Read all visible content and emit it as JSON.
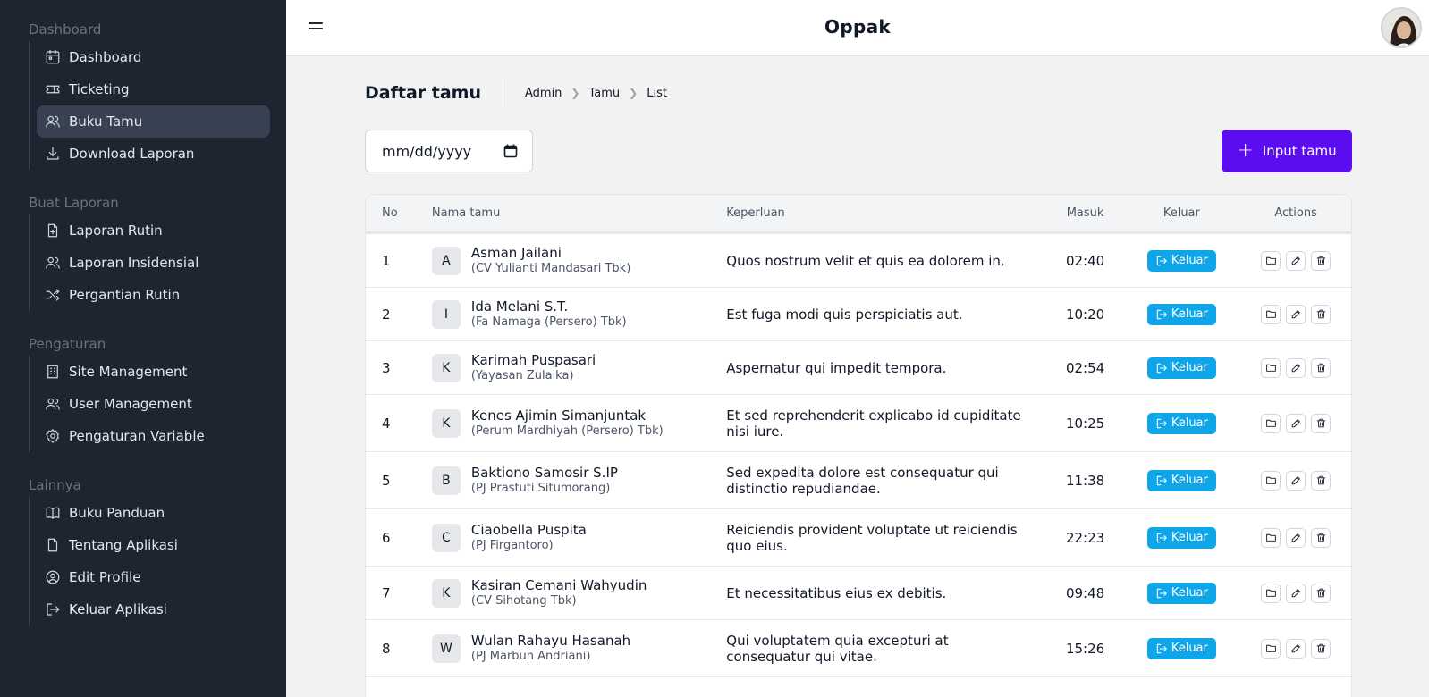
{
  "app": {
    "title": "Oppak"
  },
  "sidebar": {
    "sections": [
      {
        "title": "Dashboard",
        "items": [
          {
            "label": "Dashboard",
            "icon": "calendar-icon"
          },
          {
            "label": "Ticketing",
            "icon": "ticket-icon"
          },
          {
            "label": "Buku Tamu",
            "icon": "users-icon",
            "active": true
          },
          {
            "label": "Download Laporan",
            "icon": "download-icon"
          }
        ]
      },
      {
        "title": "Buat Laporan",
        "items": [
          {
            "label": "Laporan Rutin",
            "icon": "file-plus-icon"
          },
          {
            "label": "Laporan Insidensial",
            "icon": "users-icon"
          },
          {
            "label": "Pergantian Rutin",
            "icon": "shuffle-icon"
          }
        ]
      },
      {
        "title": "Pengaturan",
        "items": [
          {
            "label": "Site Management",
            "icon": "building-icon"
          },
          {
            "label": "User Management",
            "icon": "users-icon"
          },
          {
            "label": "Pengaturan Variable",
            "icon": "gear-icon"
          }
        ]
      },
      {
        "title": "Lainnya",
        "items": [
          {
            "label": "Buku Panduan",
            "icon": "book-icon"
          },
          {
            "label": "Tentang Aplikasi",
            "icon": "file-icon"
          },
          {
            "label": "Edit Profile",
            "icon": "user-circle-icon"
          },
          {
            "label": "Keluar Aplikasi",
            "icon": "logout-icon"
          }
        ]
      }
    ]
  },
  "page": {
    "title": "Daftar tamu",
    "breadcrumb": [
      "Admin",
      "Tamu",
      "List"
    ],
    "date_placeholder": "mm/dd/yyyy",
    "input_button": "Input tamu"
  },
  "table": {
    "columns": [
      "No",
      "Nama tamu",
      "Keperluan",
      "Masuk",
      "Keluar",
      "Actions"
    ],
    "keluar_label": "Keluar",
    "rows": [
      {
        "no": "1",
        "initial": "A",
        "name": "Asman Jailani",
        "org": "(CV Yulianti Mandasari Tbk)",
        "keperluan": "Quos nostrum velit et quis ea dolorem in.",
        "masuk": "02:40"
      },
      {
        "no": "2",
        "initial": "I",
        "name": "Ida Melani S.T.",
        "org": "(Fa Namaga (Persero) Tbk)",
        "keperluan": "Est fuga modi quis perspiciatis aut.",
        "masuk": "10:20"
      },
      {
        "no": "3",
        "initial": "K",
        "name": "Karimah Puspasari",
        "org": "(Yayasan Zulaika)",
        "keperluan": "Aspernatur qui impedit tempora.",
        "masuk": "02:54"
      },
      {
        "no": "4",
        "initial": "K",
        "name": "Kenes Ajimin Simanjuntak",
        "org": "(Perum Mardhiyah (Persero) Tbk)",
        "keperluan": "Et sed reprehenderit explicabo id cupiditate nisi iure.",
        "masuk": "10:25"
      },
      {
        "no": "5",
        "initial": "B",
        "name": "Baktiono Samosir S.IP",
        "org": "(PJ Prastuti Situmorang)",
        "keperluan": "Sed expedita dolore est consequatur qui distinctio repudiandae.",
        "masuk": "11:38"
      },
      {
        "no": "6",
        "initial": "C",
        "name": "Ciaobella Puspita",
        "org": "(PJ Firgantoro)",
        "keperluan": "Reiciendis provident voluptate ut reiciendis quo eius.",
        "masuk": "22:23"
      },
      {
        "no": "7",
        "initial": "K",
        "name": "Kasiran Cemani Wahyudin",
        "org": "(CV Sihotang Tbk)",
        "keperluan": "Et necessitatibus eius ex debitis.",
        "masuk": "09:48"
      },
      {
        "no": "8",
        "initial": "W",
        "name": "Wulan Rahayu Hasanah",
        "org": "(PJ Marbun Andriani)",
        "keperluan": "Qui voluptatem quia excepturi at consequatur qui vitae.",
        "masuk": "15:26"
      }
    ]
  },
  "colors": {
    "sidebar_bg": "#1f2530",
    "primary": "#5b0df0",
    "keluar": "#0ea5e9"
  }
}
